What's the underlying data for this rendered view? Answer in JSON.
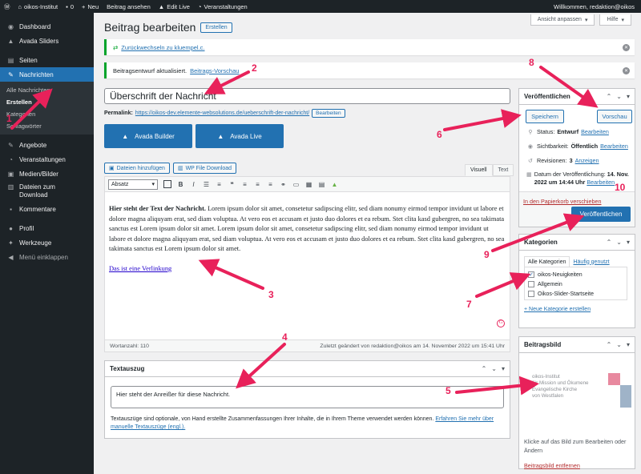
{
  "adminbar": {
    "wp_icon": "wordpress-icon",
    "site": "oikos-Institut",
    "comments_count": "0",
    "new_label": "Neu",
    "view_post": "Beitrag ansehen",
    "edit_live": "Edit Live",
    "events": "Veranstaltungen",
    "greeting": "Willkommen, redaktion@oikos"
  },
  "sidebar": {
    "items": [
      {
        "label": "Dashboard",
        "icon": "dashboard-icon"
      },
      {
        "label": "Avada Sliders",
        "icon": "avada-icon"
      },
      {
        "label": "Seiten",
        "icon": "pages-icon"
      },
      {
        "label": "Nachrichten",
        "icon": "pin-icon"
      },
      {
        "label": "Angebote",
        "icon": "pin-icon"
      },
      {
        "label": "Veranstaltungen",
        "icon": "calendar-icon"
      },
      {
        "label": "Medien/Bilder",
        "icon": "media-icon"
      },
      {
        "label": "Dateien zum Download",
        "icon": "file-icon"
      },
      {
        "label": "Kommentare",
        "icon": "comment-icon"
      },
      {
        "label": "Profil",
        "icon": "user-icon"
      },
      {
        "label": "Werkzeuge",
        "icon": "wrench-icon"
      },
      {
        "label": "Menü einklappen",
        "icon": "collapse-icon"
      }
    ],
    "submenu": [
      "Alle Nachrichten",
      "Erstellen",
      "Kategorien",
      "Schlagwörter"
    ]
  },
  "screen_meta": {
    "screen_options": "Ansicht anpassen",
    "help": "Hilfe"
  },
  "header": {
    "title": "Beitrag bearbeiten",
    "add_new": "Erstellen"
  },
  "notices": {
    "first_link": "Zurückwechseln zu kluempel.c.",
    "second_text": "Beitragsentwurf aktualisiert.",
    "second_link": "Beitrags-Vorschau"
  },
  "post": {
    "title": "Überschrift der Nachricht",
    "permalink_label": "Permalink:",
    "permalink_url": "https://oikos-dev.elemente-websolutions.de/ueberschrift-der-nachricht/",
    "permalink_edit": "Bearbeiten"
  },
  "avada": {
    "builder": "Avada Builder",
    "live": "Avada Live"
  },
  "media": {
    "add_files": "Dateien hinzufügen",
    "wp_file_download": "WP File Download"
  },
  "editor": {
    "tab_visual": "Visuell",
    "tab_text": "Text",
    "format_select": "Absatz",
    "lead": "Hier steht der Text der Nachricht.",
    "body": " Lorem ipsum dolor sit amet, consetetur sadipscing elitr, sed diam nonumy eirmod tempor invidunt ut labore et dolore magna aliquyam erat, sed diam voluptua. At vero eos et accusam et justo duo dolores et ea rebum. Stet clita kasd gubergren, no sea takimata sanctus est Lorem ipsum dolor sit amet. Lorem ipsum dolor sit amet, consetetur sadipscing elitr, sed diam nonumy eirmod tempor invidunt ut labore et dolore magna aliquyam erat, sed diam voluptua. At vero eos et accusam et justo duo dolores et ea rebum. Stet clita kasd gubergren, no sea takimata sanctus est Lorem ipsum dolor sit amet.",
    "link_text": "Das ist eine Verlinkung",
    "word_count": "Wortanzahl: 110",
    "last_edited": "Zuletzt geändert von redaktion@oikos am 14. November 2022 um 15:41 Uhr"
  },
  "excerpt": {
    "title": "Textauszug",
    "value": "Hier steht der Anreißer für diese Nachricht.",
    "help": "Textauszüge sind optionale, von Hand erstellte Zusammenfassungen Ihrer Inhalte, die in Ihrem Theme verwendet werden können.",
    "help_link": "Erfahren Sie mehr über manuelle Textauszüge (engl.)."
  },
  "publish": {
    "title": "Veröffentlichen",
    "save": "Speichern",
    "preview": "Vorschau",
    "status_label": "Status:",
    "status_value": "Entwurf",
    "visibility_label": "Sichtbarkeit:",
    "visibility_value": "Öffentlich",
    "revisions_label": "Revisionen:",
    "revisions_value": "3",
    "revisions_link": "Anzeigen",
    "date_label": "Datum der Veröffentlichung:",
    "date_value": "14. Nov. 2022 um 14:44 Uhr",
    "edit": "Bearbeiten",
    "trash": "In den Papierkorb verschieben",
    "publish_btn": "Veröffentlichen"
  },
  "categories": {
    "title": "Kategorien",
    "tab_all": "Alle Kategorien",
    "tab_popular": "Häufig genutzt",
    "items": [
      {
        "label": "oikos-Neuigkeiten",
        "checked": true
      },
      {
        "label": "Allgemein",
        "checked": false
      },
      {
        "label": "Oikos-Slider-Startseite",
        "checked": false
      }
    ],
    "add_new": "+ Neue Kategorie erstellen"
  },
  "featured_image": {
    "title": "Beitragsbild",
    "logo_lines": [
      "oikos-Institut",
      "für Mission und Ökumene",
      "Evangelische Kirche",
      "von Westfalen"
    ],
    "help": "Klicke auf das Bild zum Bearbeiten oder Ändern",
    "remove": "Beitragsbild entfernen"
  },
  "annotations": [
    "1",
    "2",
    "3",
    "4",
    "5",
    "6",
    "7",
    "8",
    "9",
    "10"
  ],
  "colors": {
    "accent": "#2271b1",
    "admin_dark": "#1d2327",
    "annotation": "#e8215a",
    "success": "#00a32a"
  }
}
